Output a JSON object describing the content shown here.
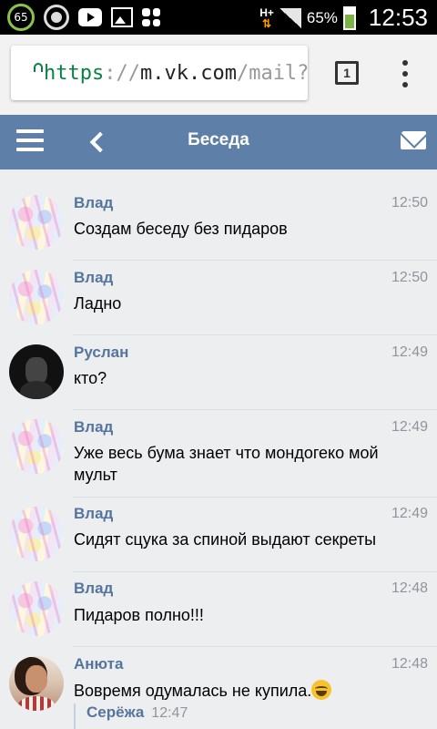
{
  "status_bar": {
    "notification_badge": "65",
    "network": "H+",
    "battery_percent": "65%",
    "time": "12:53"
  },
  "browser": {
    "url_scheme": "https",
    "url_sep": "://",
    "url_domain": "m.vk.com",
    "url_path": "/mail?a",
    "tab_count": "1"
  },
  "header": {
    "title": "Беседа"
  },
  "messages": [
    {
      "author": "Влад",
      "time": "12:50",
      "text": "Создам беседу без пидаров"
    },
    {
      "author": "Влад",
      "time": "12:50",
      "text": "Ладно"
    },
    {
      "author": "Руслан",
      "time": "12:49",
      "text": "кто?"
    },
    {
      "author": "Влад",
      "time": "12:49",
      "text": "Уже весь бума знает что мондогеко мой мульт"
    },
    {
      "author": "Влад",
      "time": "12:49",
      "text": "Сидят сцука за спиной выдают секреты"
    },
    {
      "author": "Влад",
      "time": "12:48",
      "text": "Пидаров полно!!!"
    },
    {
      "author": "Анюта",
      "time": "12:48",
      "text": "Вовремя одумалась не купила.",
      "emoji": "grinning-face-sweat"
    }
  ],
  "forwarded": {
    "author": "Серёжа",
    "time": "12:47"
  }
}
